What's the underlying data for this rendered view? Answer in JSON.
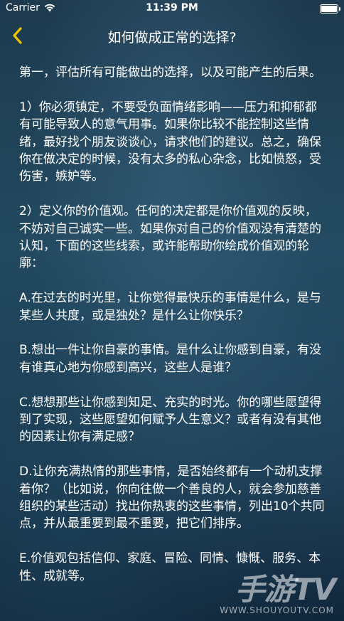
{
  "status": {
    "carrier": "Carrier",
    "time": "11:39 PM"
  },
  "nav": {
    "title": "如何做成正常的选择?"
  },
  "paragraphs": [
    "第一，评估所有可能做出的选择，以及可能产生的后果。",
    "1）你必须镇定，不要受负面情绪影响——压力和抑郁都有可能导致人的意气用事。如果你比较不能控制这些情绪，最好找个朋友谈谈心，请求他们的建议。总之，确保你在做决定的时候，没有太多的私心杂念，比如愤怒，受伤害，嫉妒等。",
    "2）定义你的价值观。任何的决定都是你价值观的反映，不妨对自己诚实一些。如果你对自己的价值观没有清楚的认知，下面的这些线索，或许能帮助你绘成价值观的轮廓：",
    "A.在过去的时光里，让你觉得最快乐的事情是什么，是与某些人共度，或是独处？是什么让你快乐？",
    "B.想出一件让你自豪的事情。是什么让你感到自豪，有没有谁真心地为你感到高兴，这些人是谁？",
    "C.想想那些让你感到知足、充实的时光。你的哪些愿望得到了实现，这些愿望如何赋予人生意义？或者有没有其他的因素让你有满足感？",
    "D.让你充满热情的那些事情，是否始终都有一个动机支撑着你？（比如说，你向往做一个善良的人，就会参加慈善组织的某些活动）找出你热衷的这些事情，列出10个共同点，并从最重要到最不重要，把它们排序。",
    "E.价值观包括信仰、家庭、冒险、同情、慷慨、服务、本性、成就等。"
  ],
  "watermark": {
    "brand": "手游TV",
    "url": "WWW.SHOUYOUTV.COM"
  },
  "colors": {
    "back_arrow": "#f2c200",
    "text": "#ffffff"
  }
}
